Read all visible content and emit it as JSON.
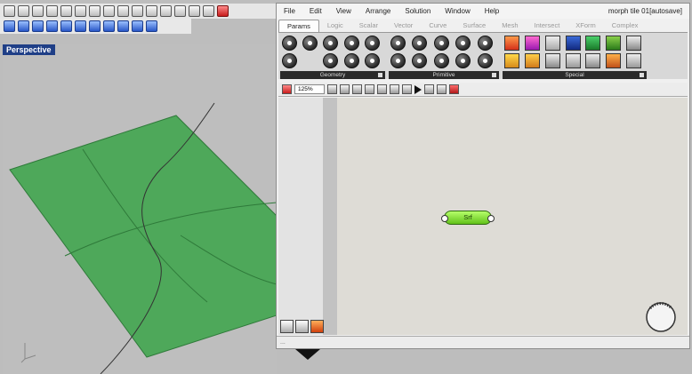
{
  "viewport": {
    "label": "Perspective"
  },
  "grasshopper": {
    "title": "morph tile 01[autosave]",
    "menu": [
      "File",
      "Edit",
      "View",
      "Arrange",
      "Solution",
      "Window",
      "Help"
    ],
    "tabs": [
      "Params",
      "Logic",
      "Scalar",
      "Vector",
      "Curve",
      "Surface",
      "Mesh",
      "Intersect",
      "XForm",
      "Complex"
    ],
    "active_tab": "Params",
    "ribbon_groups": [
      "Geometry",
      "Primitive",
      "Special"
    ],
    "zoom": "125%",
    "component_label": "Srf"
  },
  "colors": {
    "surface": "#4ea85a",
    "surface_stroke": "#2f7a3a",
    "component": "#7cd63a"
  }
}
